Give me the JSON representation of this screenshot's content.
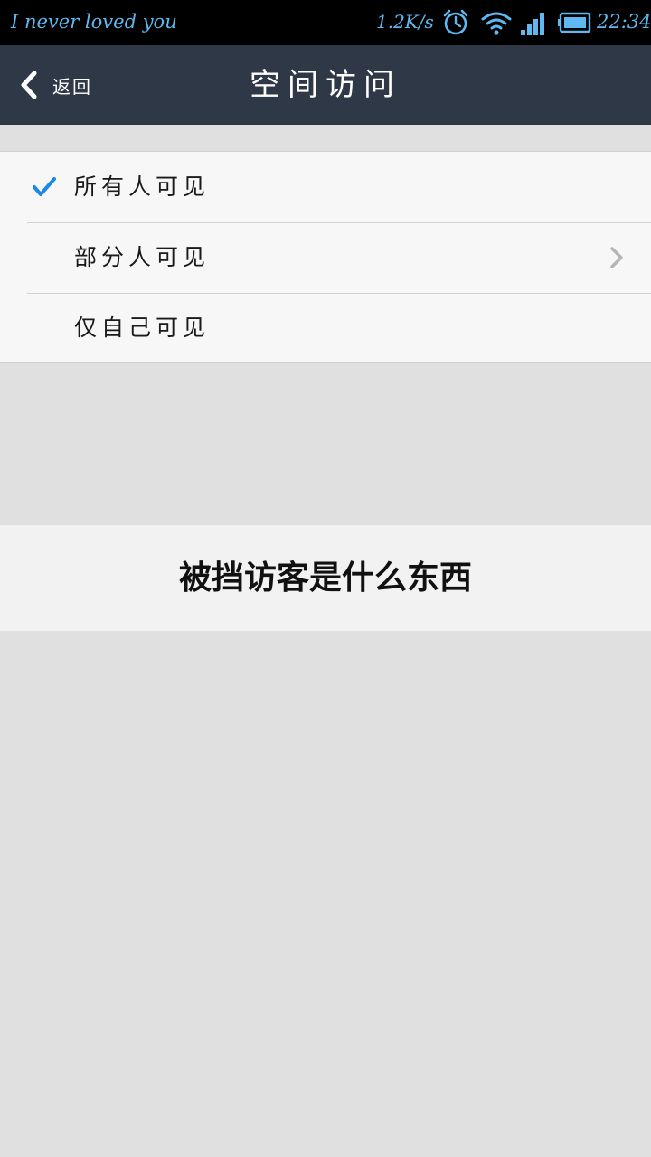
{
  "status_bar": {
    "notification_text": "I never loved you",
    "net_speed": "1.2K/s",
    "icons": [
      "alarm-icon",
      "wifi-icon",
      "signal-icon",
      "battery-icon"
    ],
    "time": "22:34",
    "text_color": "#5fb8f0"
  },
  "title_bar": {
    "back_label": "返回",
    "title": "空间访问",
    "background": "#2f3847"
  },
  "options": [
    {
      "label": "所有人可见",
      "selected": true,
      "has_chevron": false
    },
    {
      "label": "部分人可见",
      "selected": false,
      "has_chevron": true
    },
    {
      "label": "仅自己可见",
      "selected": false,
      "has_chevron": false
    }
  ],
  "accent_color": "#1e88e5",
  "banner": {
    "text": "被挡访客是什么东西"
  }
}
